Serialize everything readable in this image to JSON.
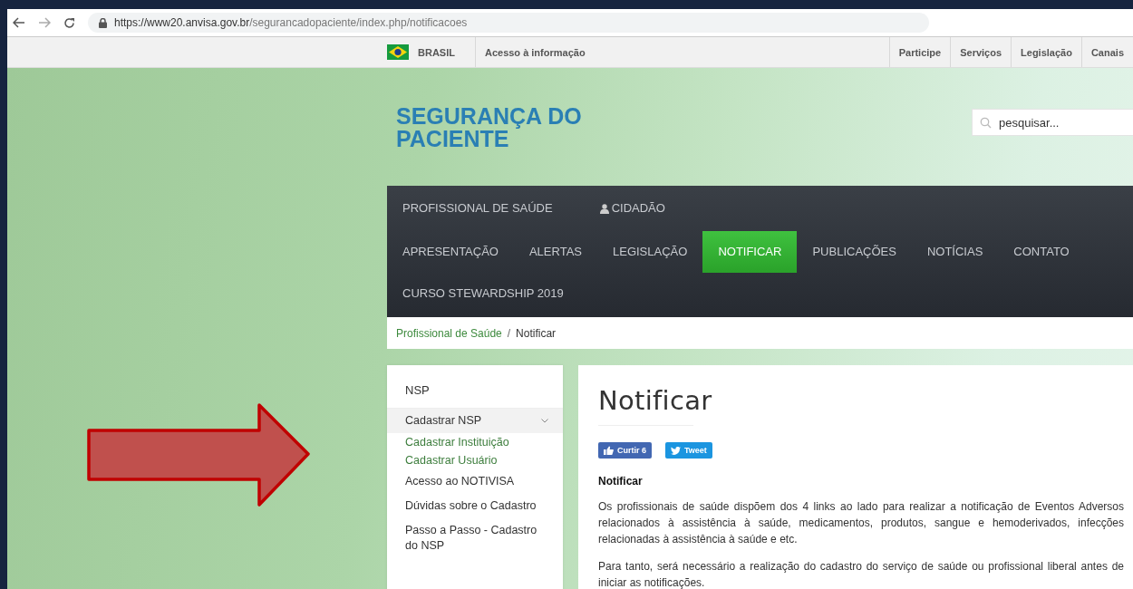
{
  "browser": {
    "url_host": "https://www20.anvisa.gov.br",
    "url_path": "/segurancadopaciente/index.php/notificacoes"
  },
  "gov_bar": {
    "country": "BRASIL",
    "access": "Acesso à informação",
    "links": [
      "Participe",
      "Serviços",
      "Legislação",
      "Canais"
    ]
  },
  "site_title": "SEGURANÇA DO PACIENTE",
  "search": {
    "placeholder": "pesquisar..."
  },
  "nav": {
    "audience": [
      {
        "label": "PROFISSIONAL DE SAÚDE",
        "kind": "plain"
      },
      {
        "label": "CIDADÃO",
        "kind": "with_icon"
      }
    ],
    "items": [
      {
        "label": "APRESENTAÇÃO",
        "selected": false
      },
      {
        "label": "ALERTAS",
        "selected": false
      },
      {
        "label": "LEGISLAÇÃO",
        "selected": false
      },
      {
        "label": "NOTIFICAR",
        "selected": true
      },
      {
        "label": "PUBLICAÇÕES",
        "selected": false
      },
      {
        "label": "NOTÍCIAS",
        "selected": false
      },
      {
        "label": "CONTATO",
        "selected": false
      },
      {
        "label": "CURSO STEWARDSHIP 2019",
        "selected": false
      }
    ]
  },
  "breadcrumb": {
    "links": [
      "Profissional de Saúde"
    ],
    "separator": "/",
    "current": "Notificar"
  },
  "sidebar": {
    "title": "NSP",
    "items": [
      {
        "label": "Cadastrar NSP",
        "expanded": true,
        "children": [
          {
            "label": "Cadastrar Instituição"
          },
          {
            "label": "Cadastrar Usuário"
          }
        ]
      },
      {
        "label": "Acesso ao NOTIVISA"
      },
      {
        "label": "Dúvidas sobre o Cadastro"
      },
      {
        "label": "Passo a Passo - Cadastro do NSP"
      }
    ]
  },
  "article": {
    "title": "Notificar",
    "social": [
      {
        "kind": "like",
        "label": "Curtir 6"
      },
      {
        "kind": "tweet",
        "label": "Tweet"
      }
    ],
    "subheading": "Notificar",
    "paragraphs": [
      "Os profissionais de saúde dispõem dos 4 links ao lado para realizar a notificação de Eventos Adversos relacionados à assistência à saúde, medicamentos, produtos, sangue e hemoderivados, infecções relacionadas à assistência à saúde e etc.",
      "Para tanto, será necessário a realização do cadastro do serviço de saúde ou profissional liberal antes de iniciar as notificações."
    ]
  }
}
